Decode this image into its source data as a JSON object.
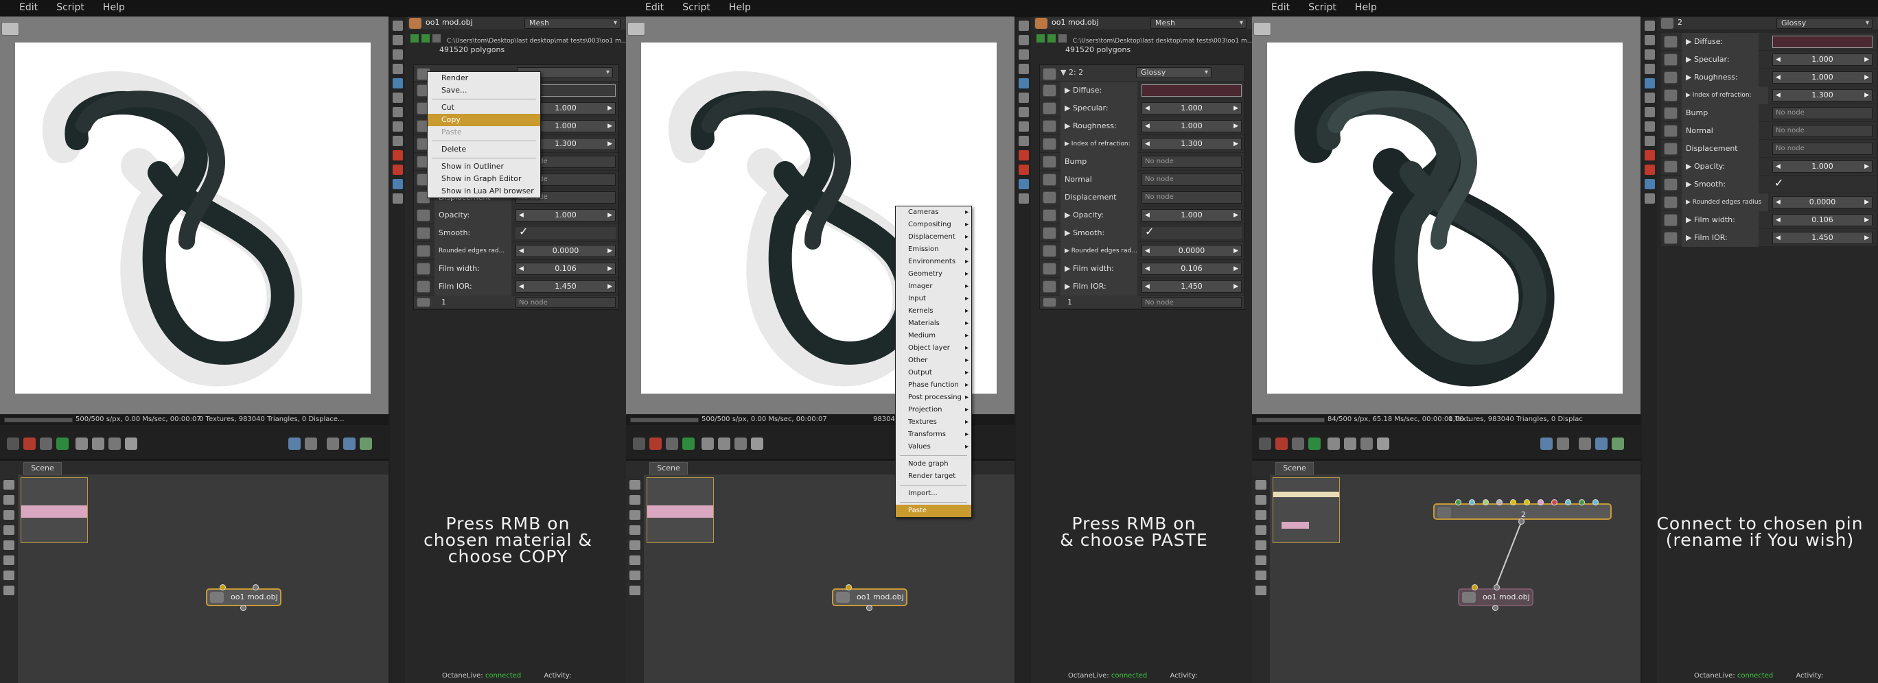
{
  "menu": [
    "Edit",
    "Script",
    "Help"
  ],
  "steps": [
    {
      "status": "500/500 s/px, 0.00 Ms/sec, 00:00:07",
      "status_right": "0 Textures, 983040 Triangles, 0 Displace...",
      "caption_lines": [
        "Press RMB on",
        "chosen material &",
        "choose COPY"
      ]
    },
    {
      "status": "500/500 s/px, 0.00 Ms/sec, 00:00:07",
      "status_right": "983040 Triang",
      "caption_lines": [
        "Press RMB on",
        "& choose PASTE"
      ]
    },
    {
      "status": "84/500 s/px, 65.18 Ms/sec, 00:00:01,00...",
      "status_right": "0 Textures, 983040 Triangles, 0 Displac",
      "caption_lines": [
        "Connect to chosen pin",
        "(rename if You wish)"
      ]
    }
  ],
  "scene_tab": "Scene",
  "mesh_node_label": "oo1 mod.obj",
  "material_node_label": "2",
  "inspector": {
    "title": "oo1 mod.obj",
    "type": "Mesh",
    "path": "C:\\Users\\tom\\Desktop\\last desktop\\mat tests\\003\\oo1 m...",
    "polygons": "491520 polygons",
    "material_name": "2",
    "material_header": "2: 2",
    "material_type": "Glossy",
    "pin_row_label": "1",
    "no_node": "No node",
    "params": [
      {
        "label": "Diffuse:",
        "kind": "color"
      },
      {
        "label": "Specular:",
        "kind": "value",
        "value": "1.000"
      },
      {
        "label": "Roughness:",
        "kind": "value",
        "value": "1.000"
      },
      {
        "label": "Index of refraction:",
        "kind": "value",
        "value": "1.300"
      },
      {
        "label": "Bump",
        "kind": "node"
      },
      {
        "label": "Normal",
        "kind": "node"
      },
      {
        "label": "Displacement",
        "kind": "node"
      },
      {
        "label": "Opacity:",
        "kind": "value",
        "value": "1.000"
      },
      {
        "label": "Smooth:",
        "kind": "check"
      },
      {
        "label": "Rounded edges rad...",
        "kind": "value",
        "value": "0.0000"
      },
      {
        "label": "Film width:",
        "kind": "value",
        "value": "0.106"
      },
      {
        "label": "Film IOR:",
        "kind": "value",
        "value": "1.450"
      }
    ],
    "rounded_edges_full": "Rounded edges radius"
  },
  "copy_menu": {
    "items": [
      {
        "label": "Render",
        "state": "normal"
      },
      {
        "label": "Save...",
        "state": "normal"
      },
      {
        "sep": true
      },
      {
        "label": "Cut",
        "state": "normal"
      },
      {
        "label": "Copy",
        "state": "highlight"
      },
      {
        "label": "Paste",
        "state": "disabled"
      },
      {
        "sep": true
      },
      {
        "label": "Delete",
        "state": "normal"
      },
      {
        "sep": true
      },
      {
        "label": "Show in Outliner",
        "state": "normal"
      },
      {
        "label": "Show in Graph Editor",
        "state": "normal"
      },
      {
        "label": "Show in Lua API browser",
        "state": "normal"
      }
    ]
  },
  "paste_menu": {
    "items": [
      "Cameras",
      "Compositing",
      "Displacement",
      "Emission",
      "Environments",
      "Geometry",
      "Imager",
      "Input",
      "Kernels",
      "Materials",
      "Medium",
      "Object layer",
      "Other",
      "Output",
      "Phase function",
      "Post processing",
      "Projection",
      "Textures",
      "Transforms",
      "Values"
    ],
    "extra": [
      "Node graph",
      "Render target",
      "Import...",
      "Paste"
    ]
  },
  "live": {
    "label": "OctaneLive:",
    "state": "connected",
    "activity": "Activity:"
  }
}
